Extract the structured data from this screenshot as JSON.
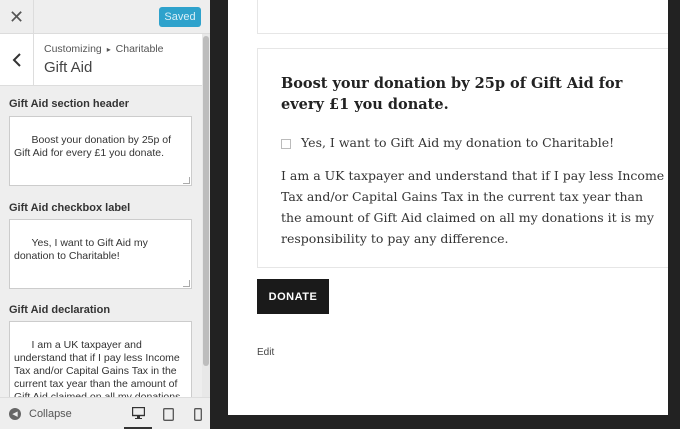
{
  "topbar": {
    "close_icon": "close-icon",
    "saved_label": "Saved"
  },
  "section": {
    "breadcrumb_parent": "Customizing",
    "breadcrumb_child": "Charitable",
    "title": "Gift Aid"
  },
  "controls": [
    {
      "label": "Gift Aid section header",
      "value": "Boost your donation by 25p of Gift Aid for every £1 you donate."
    },
    {
      "label": "Gift Aid checkbox label",
      "value": "Yes, I want to Gift Aid my donation to Charitable!"
    },
    {
      "label": "Gift Aid declaration",
      "value": "I am a UK taxpayer and understand that if I pay less Income Tax and/or Capital Gains Tax in the current tax year than the amount of Gift Aid claimed on all my donations it is my responsibility to pay any difference."
    }
  ],
  "footer": {
    "collapse_label": "Collapse"
  },
  "preview": {
    "gift_header": "Boost your donation by 25p of Gift Aid for every £1 you donate.",
    "checkbox_label": "Yes, I want to Gift Aid my donation to Charitable!",
    "declaration": "I am a UK taxpayer and understand that if I pay less Income Tax and/or Capital Gains Tax in the current tax year than the amount of Gift Aid claimed on all my donations it is my responsibility to pay any difference.",
    "donate_label": "DONATE",
    "edit_label": "Edit"
  },
  "colors": {
    "accent": "#2ea2cc",
    "dark": "#1a1a1a"
  }
}
